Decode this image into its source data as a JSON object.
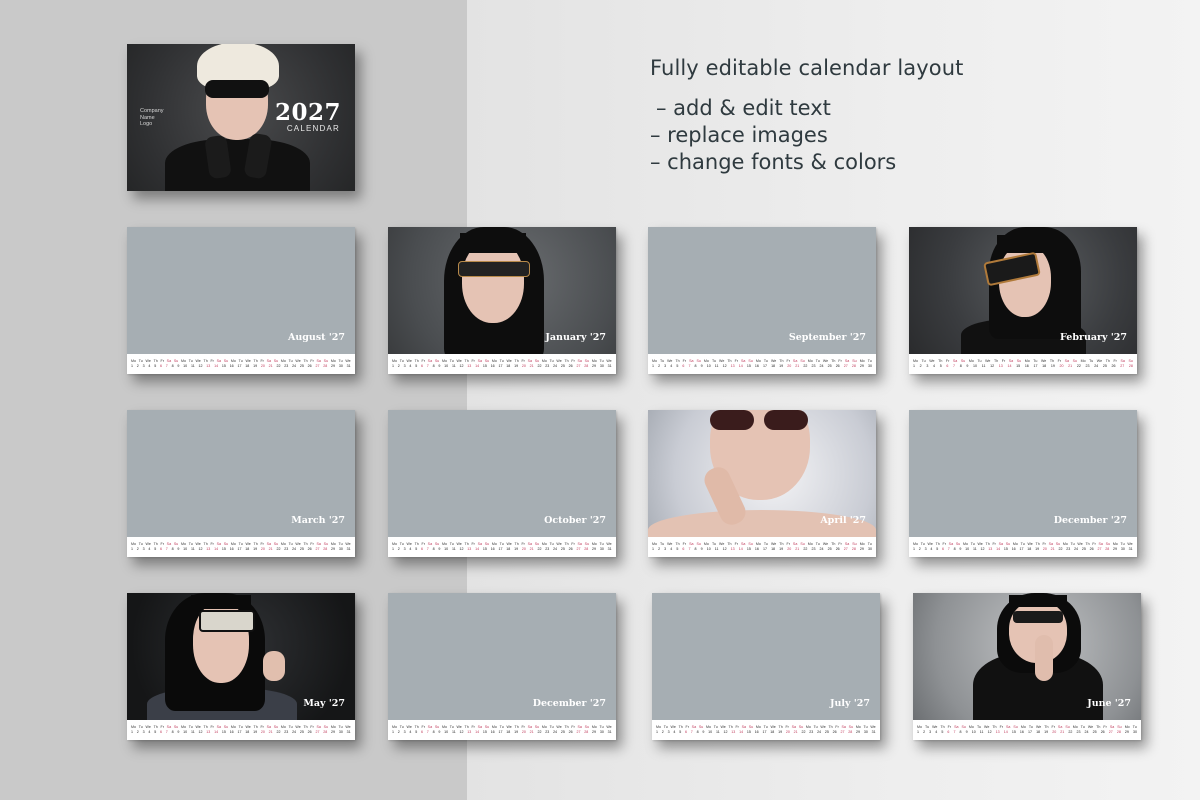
{
  "headline": "Fully editable calendar layout",
  "features": [
    "– add & edit text",
    "– replace images",
    "– change fonts & colors"
  ],
  "cover": {
    "logo_lines": [
      "Company",
      "Name",
      "Logo"
    ],
    "year": "2027",
    "label": "CALENDAR"
  },
  "months": {
    "aug": "August '27",
    "jan": "January '27",
    "sep": "September '27",
    "feb": "February '27",
    "mar": "March '27",
    "oct": "October '27",
    "apr": "April '27",
    "dec1": "December '27",
    "may": "May '27",
    "dec2": "December '27",
    "jul": "July '27",
    "jun": "June '27"
  },
  "colors": {
    "placeholder": "#a6aeb3",
    "weekend": "#c0395a",
    "text": "#2f3a3f"
  }
}
